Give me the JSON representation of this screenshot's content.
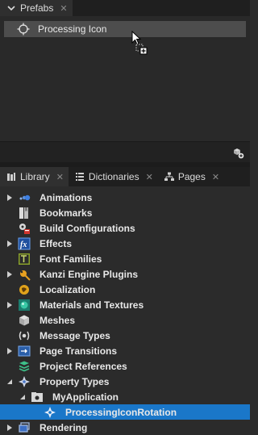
{
  "prefabs_tab": {
    "label": "Prefabs"
  },
  "prefabs": {
    "items": [
      {
        "label": "Processing Icon"
      }
    ]
  },
  "library_tabs": [
    {
      "label": "Library"
    },
    {
      "label": "Dictionaries"
    },
    {
      "label": "Pages"
    }
  ],
  "tree": [
    {
      "label": "Animations",
      "icon": "animations-icon"
    },
    {
      "label": "Bookmarks",
      "icon": "bookmarks-icon"
    },
    {
      "label": "Build Configurations",
      "icon": "build-configurations-icon"
    },
    {
      "label": "Effects",
      "icon": "effects-icon"
    },
    {
      "label": "Font Families",
      "icon": "font-families-icon"
    },
    {
      "label": "Kanzi Engine Plugins",
      "icon": "plugins-icon"
    },
    {
      "label": "Localization",
      "icon": "localization-icon"
    },
    {
      "label": "Materials and Textures",
      "icon": "materials-icon"
    },
    {
      "label": "Meshes",
      "icon": "meshes-icon"
    },
    {
      "label": "Message Types",
      "icon": "message-types-icon"
    },
    {
      "label": "Page Transitions",
      "icon": "page-transitions-icon"
    },
    {
      "label": "Project References",
      "icon": "project-references-icon"
    },
    {
      "label": "Property Types",
      "icon": "property-types-icon"
    },
    {
      "label": "MyApplication",
      "icon": "folder-icon"
    },
    {
      "label": "ProcessingIconRotation",
      "icon": "property-type-icon"
    },
    {
      "label": "Rendering",
      "icon": "rendering-icon"
    }
  ],
  "colors": {
    "selection": "#1a77c9",
    "panel": "#2b2b2b",
    "tabbar": "#1f1f1f"
  }
}
